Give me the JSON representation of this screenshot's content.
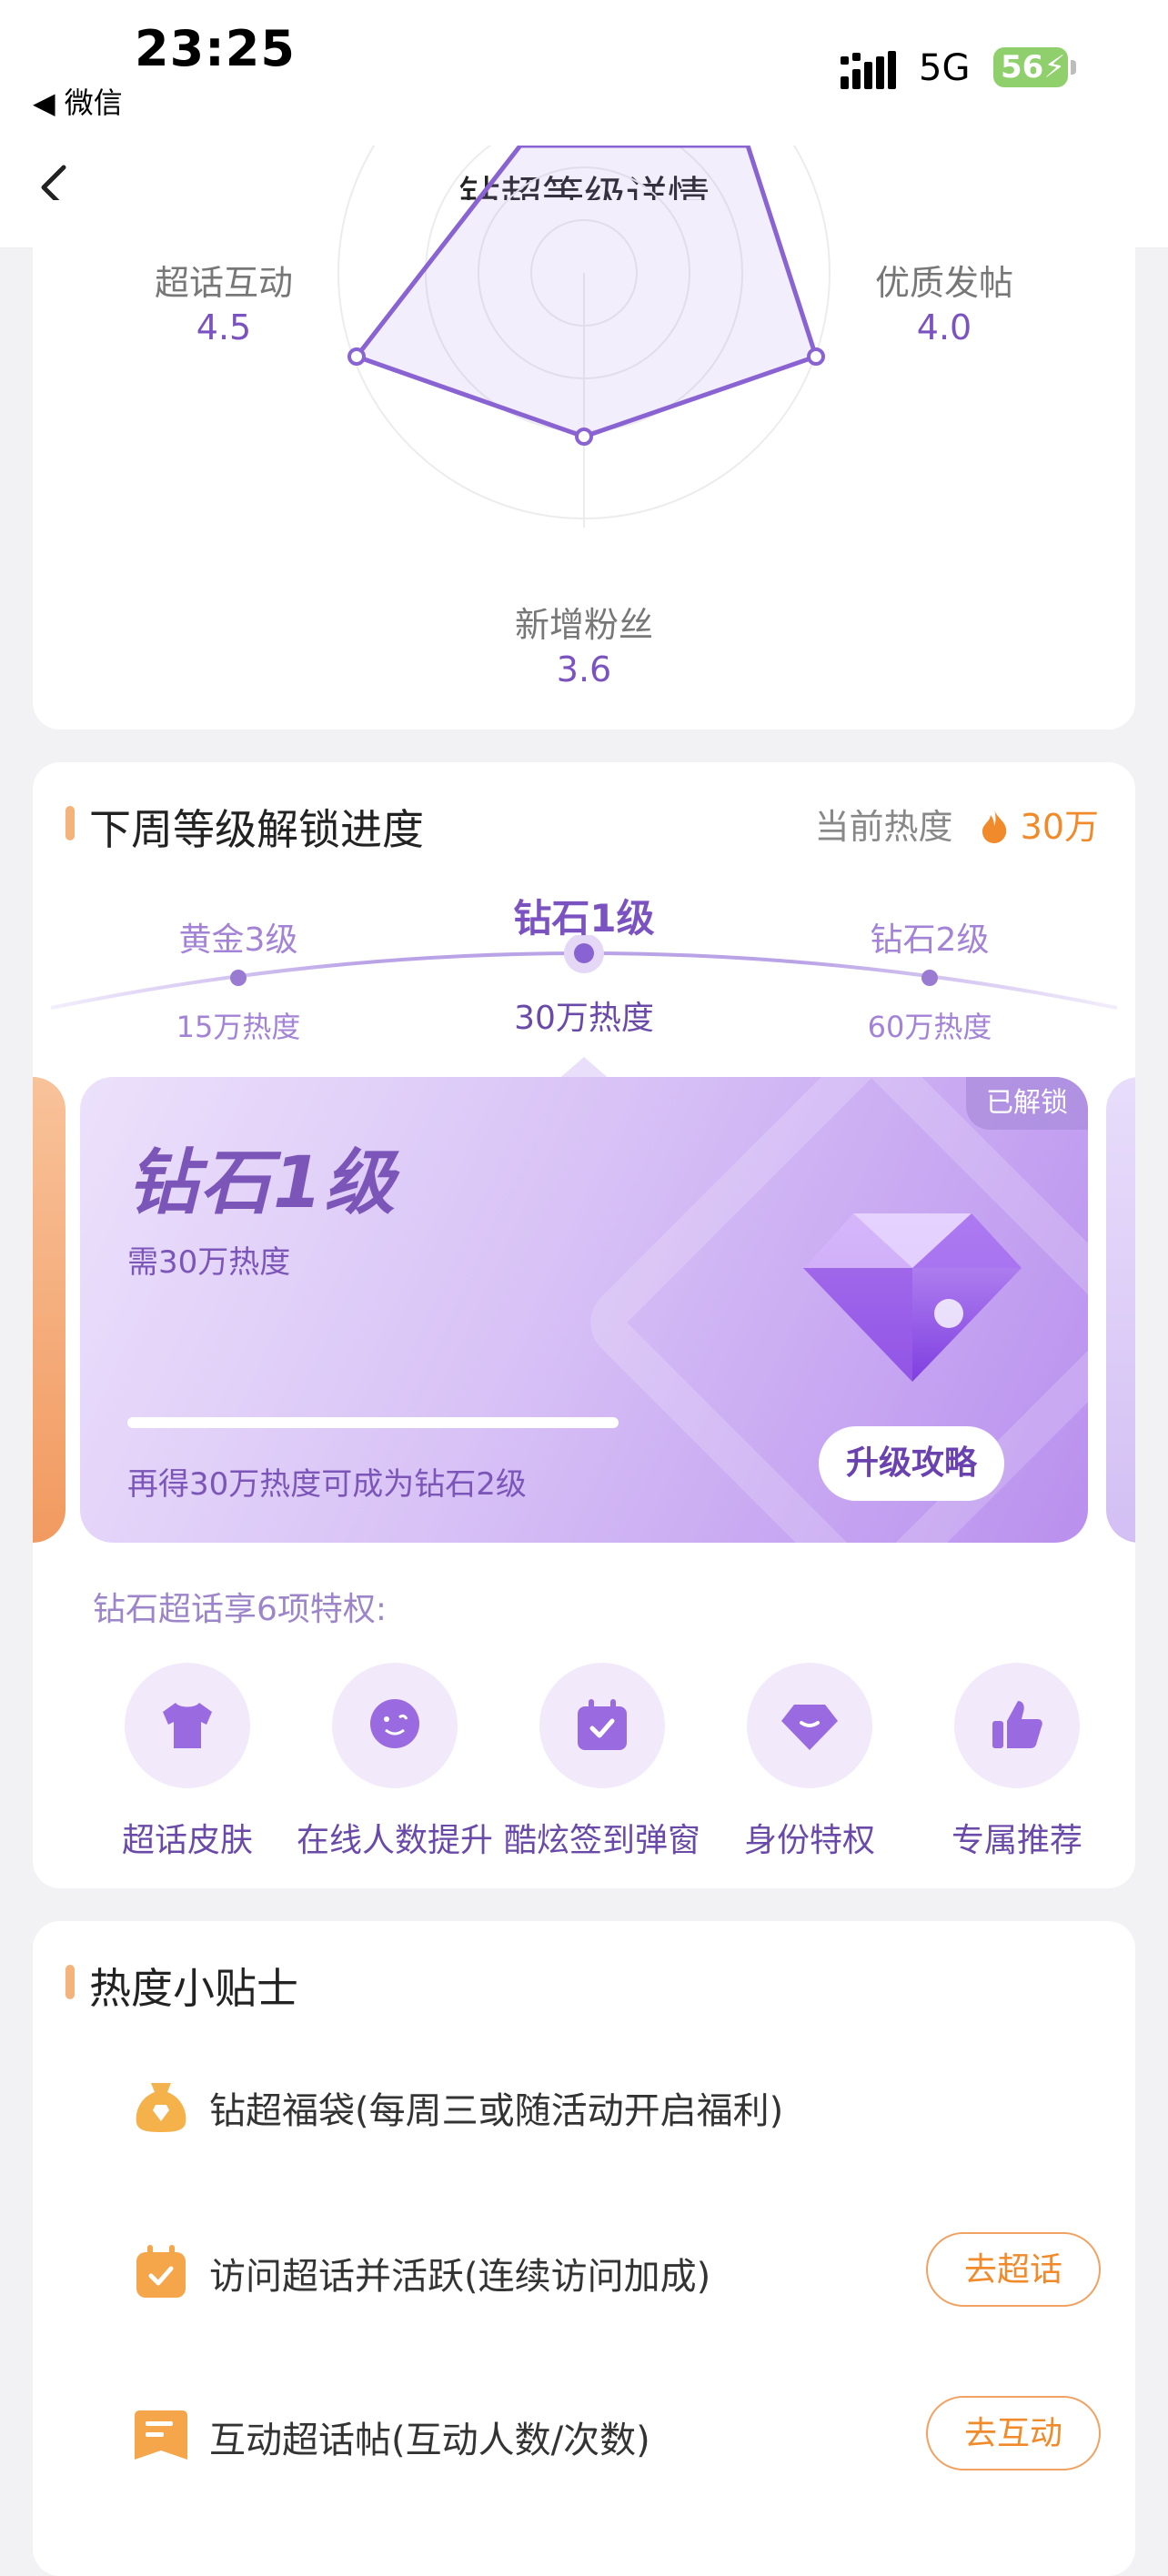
{
  "status": {
    "time": "23:25",
    "back_app": "◀ 微信",
    "network": "5G",
    "battery": "56"
  },
  "nav": {
    "title": "钻超等级详情",
    "back_icon": "chevron-left-icon"
  },
  "radar": {
    "left_label": "超话互动",
    "left_value": "4.5",
    "right_label": "优质发帖",
    "right_value": "4.0",
    "bottom_label": "新增粉丝",
    "bottom_value": "3.6"
  },
  "unlock": {
    "title": "下周等级解锁进度",
    "current_heat_label": "当前热度",
    "current_heat_value": "30万",
    "levels": [
      {
        "name": "黄金3级",
        "heat": "15万热度"
      },
      {
        "name": "钻石1级",
        "heat": "30万热度"
      },
      {
        "name": "钻石2级",
        "heat": "60万热度"
      }
    ],
    "card": {
      "badge": "已解锁",
      "name": "钻石1级",
      "need": "需30万热度",
      "tip": "再得30万热度可成为钻石2级",
      "button": "升级攻略",
      "progress_fraction": 1.0
    },
    "privileges_title": "钻石超话享6项特权:",
    "privileges": [
      {
        "label": "超话皮肤",
        "icon": "tshirt-icon"
      },
      {
        "label": "在线人数提升",
        "icon": "smile-chat-icon"
      },
      {
        "label": "酷炫签到弹窗",
        "icon": "calendar-check-icon"
      },
      {
        "label": "身份特权",
        "icon": "diamond-icon"
      },
      {
        "label": "专属推荐",
        "icon": "thumbs-up-icon"
      }
    ]
  },
  "tips": {
    "title": "热度小贴士",
    "items": [
      {
        "text": "钻超福袋(每周三或随活动开启福利)",
        "icon": "lucky-bag-icon",
        "button": ""
      },
      {
        "text": "访问超话并活跃(连续访问加成)",
        "icon": "calendar-check-icon",
        "button": "去超话"
      },
      {
        "text": "互动超话帖(互动人数/次数)",
        "icon": "post-icon",
        "button": "去互动"
      }
    ]
  },
  "colors": {
    "accent": "#7b53c1",
    "orange": "#f08a2a",
    "card_bg": "#ffffff"
  }
}
